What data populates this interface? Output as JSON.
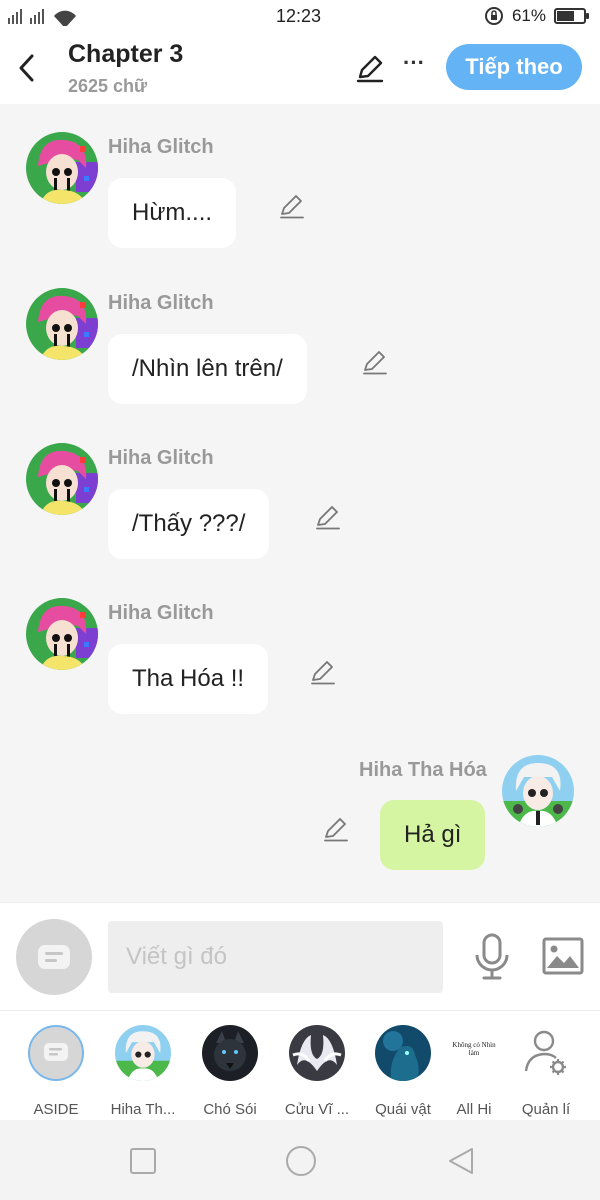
{
  "status_bar": {
    "time": "12:23",
    "battery_percent": "61%",
    "battery_level": 0.61,
    "icons": [
      "signal-icon",
      "wifi-icon",
      "lock-rotation-icon",
      "battery-icon"
    ]
  },
  "header": {
    "title": "Chapter 3",
    "subtitle": "2625 chữ",
    "next_label": "Tiếp theo",
    "more_label": "···"
  },
  "messages": [
    {
      "author": "Hiha Glitch",
      "text": "Hừm....",
      "side": "left"
    },
    {
      "author": "Hiha Glitch",
      "text": "/Nhìn lên trên/",
      "side": "left"
    },
    {
      "author": "Hiha Glitch",
      "text": "/Thấy ???/",
      "side": "left"
    },
    {
      "author": "Hiha Glitch",
      "text": "Tha Hóa !!",
      "side": "left"
    },
    {
      "author": "Hiha Tha Hóa",
      "text": "Hả gì",
      "side": "right"
    }
  ],
  "input": {
    "placeholder": "Viết gì đó"
  },
  "characters": [
    {
      "label": "ASIDE"
    },
    {
      "label": "Hiha Th..."
    },
    {
      "label": "Chó Sói"
    },
    {
      "label": "Cửu Vĩ ..."
    },
    {
      "label": "Quái vật"
    },
    {
      "label": "All Hi",
      "thumb_text": "Không có Nhìn làm"
    },
    {
      "label": "Quản lí"
    }
  ],
  "colors": {
    "accent": "#63b3f5",
    "my_bubble": "#d6f5a3",
    "bubble": "#ffffff",
    "background": "#f5f5f5"
  }
}
